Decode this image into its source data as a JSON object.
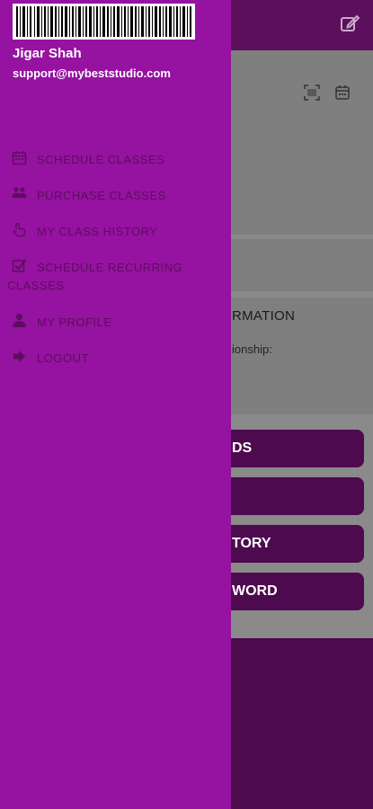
{
  "drawer": {
    "user_name": "Jigar Shah",
    "user_email": "support@mybeststudio.com",
    "menu": [
      {
        "label": "SCHEDULE CLASSES",
        "icon": "calendar-icon"
      },
      {
        "label": "PURCHASE CLASSES",
        "icon": "users-icon"
      },
      {
        "label": "MY CLASS HISTORY",
        "icon": "hand-pointer-icon"
      },
      {
        "label": "SCHEDULE RECURRING CLASSES",
        "icon": "checkbox-icon"
      },
      {
        "label": "MY PROFILE",
        "icon": "user-icon"
      },
      {
        "label": "LOGOUT",
        "icon": "sign-out-icon"
      }
    ]
  },
  "background": {
    "info_title": "RMATION",
    "info_line": "ionship:",
    "buttons": [
      {
        "label": "DS"
      },
      {
        "label": ""
      },
      {
        "label": "TORY"
      },
      {
        "label": "WORD"
      }
    ]
  },
  "colors": {
    "drawer_bg": "#9612a0",
    "header_bg": "#5c0f5c",
    "menu_text": "#5c0e5e",
    "button_bg": "#4e0a4e"
  }
}
